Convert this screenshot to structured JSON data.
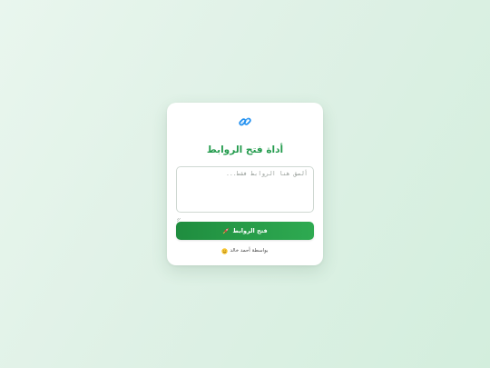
{
  "app": {
    "title": "أداة فتح الروابط"
  },
  "logo": {
    "icon": "link-icon",
    "color": "#1f8ff0"
  },
  "input": {
    "placeholder": "ألصق هنا الروابط فقط...",
    "value": ""
  },
  "button": {
    "label": "فتح الروابط",
    "icon": "rocket-icon",
    "color": "#239b4d"
  },
  "footer": {
    "text": "بواسطة أحمد خالد",
    "icon": "smile-icon"
  },
  "colors": {
    "accent": "#239b4d",
    "background": "#dff1e6"
  }
}
